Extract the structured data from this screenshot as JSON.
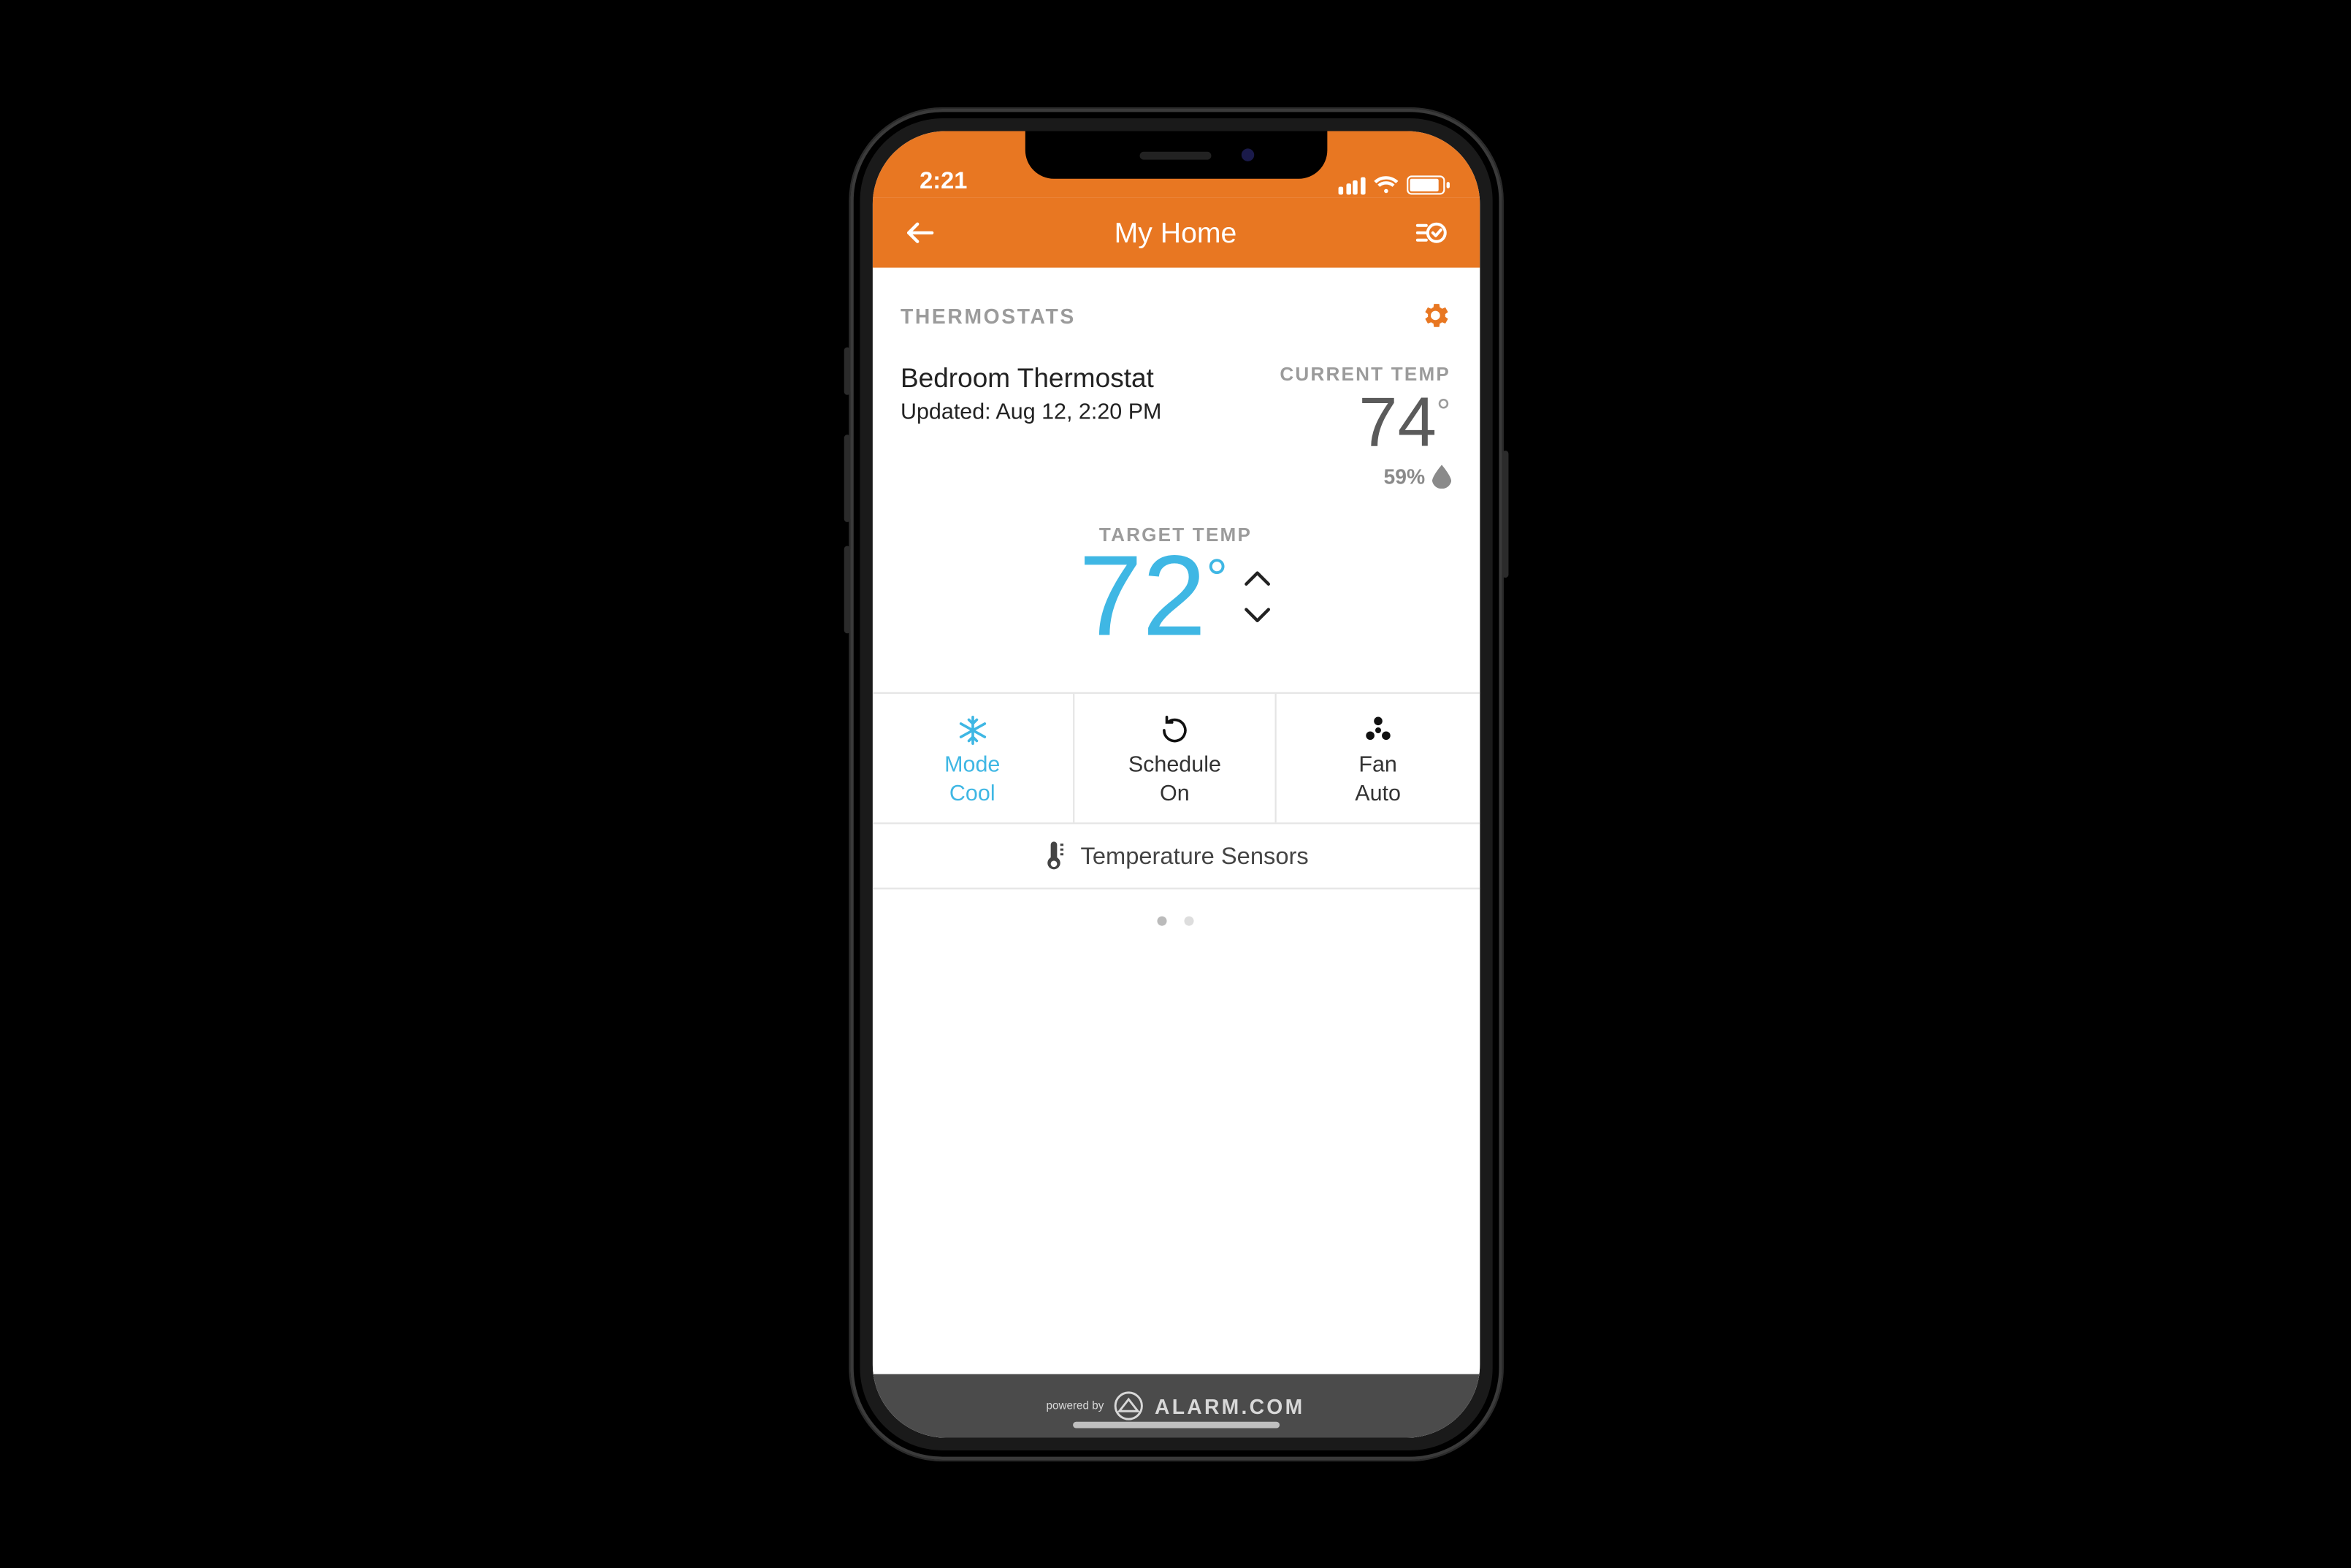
{
  "status": {
    "time": "2:21"
  },
  "nav": {
    "title": "My Home"
  },
  "section": {
    "label": "THERMOSTATS"
  },
  "thermostat": {
    "name": "Bedroom Thermostat",
    "updated": "Updated: Aug 12, 2:20 PM",
    "current_label": "CURRENT TEMP",
    "current_value": "74",
    "humidity": "59%",
    "target_label": "TARGET TEMP",
    "target_value": "72"
  },
  "modes": {
    "mode": {
      "line1": "Mode",
      "line2": "Cool"
    },
    "schedule": {
      "line1": "Schedule",
      "line2": "On"
    },
    "fan": {
      "line1": "Fan",
      "line2": "Auto"
    }
  },
  "sensors": {
    "label": "Temperature Sensors"
  },
  "footer": {
    "powered": "powered by",
    "brand": "ALARM.COM"
  },
  "colors": {
    "accent": "#e87722",
    "cool": "#3fb7e4"
  }
}
